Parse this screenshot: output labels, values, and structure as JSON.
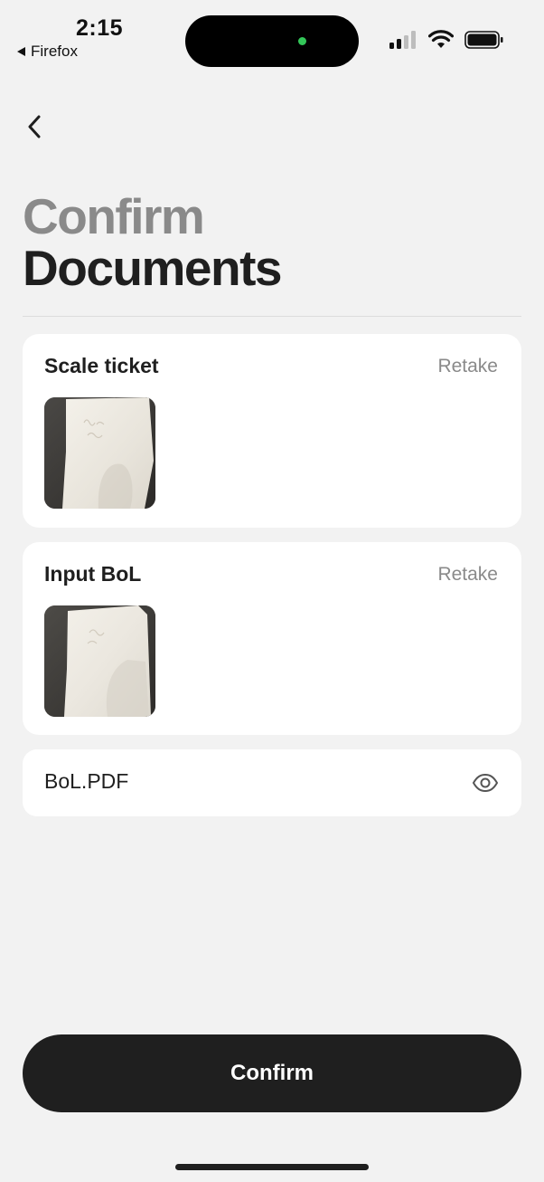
{
  "status_bar": {
    "time": "2:15",
    "return_app": "Firefox"
  },
  "header": {
    "title_line1": "Confirm",
    "title_line2": "Documents"
  },
  "documents": [
    {
      "title": "Scale ticket",
      "action": "Retake"
    },
    {
      "title": "Input BoL",
      "action": "Retake"
    }
  ],
  "attachment": {
    "file_name": "BoL.PDF"
  },
  "footer": {
    "confirm_label": "Confirm"
  },
  "colors": {
    "background": "#f2f2f2",
    "card": "#ffffff",
    "primary_button": "#1f1f1f",
    "muted_text": "#8a8a8a",
    "indicator_green": "#33c759"
  }
}
